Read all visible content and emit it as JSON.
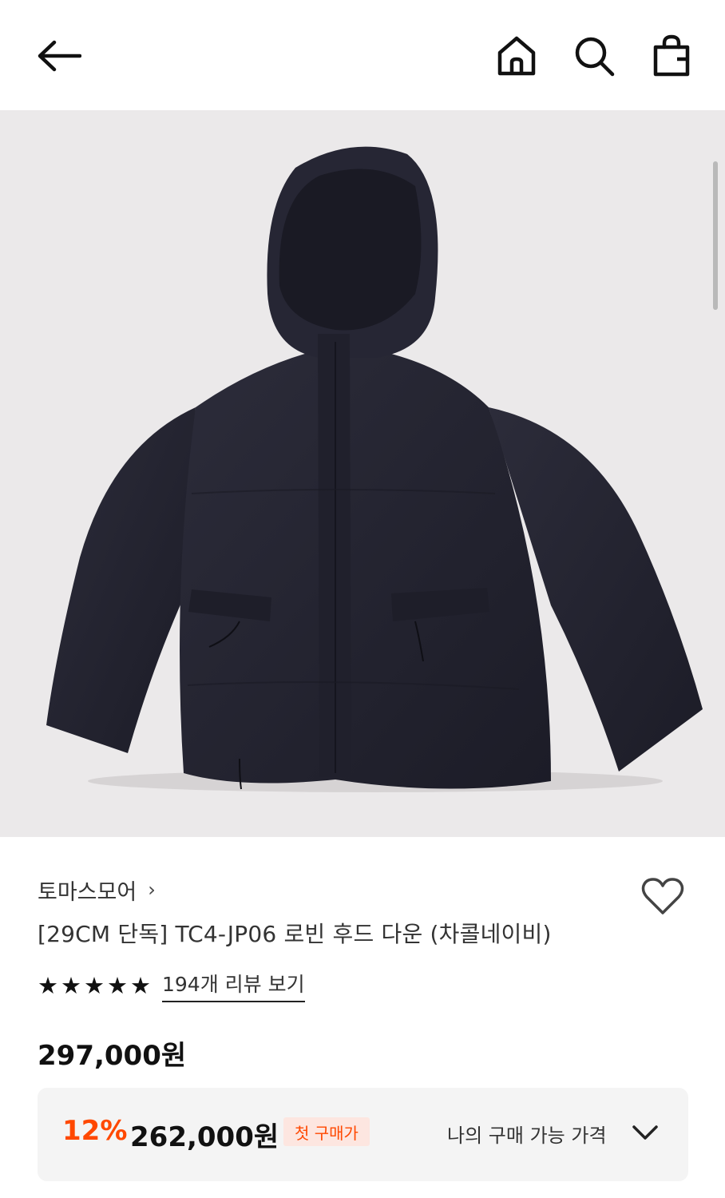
{
  "header": {
    "back_icon": "arrow-left-icon",
    "home_icon": "home-icon",
    "search_icon": "search-icon",
    "bag_icon": "shopping-bag-icon"
  },
  "product": {
    "image_alt": "navy hooded down jacket",
    "brand": "토마스모어",
    "brand_chevron": "›",
    "title": "[29CM 단독] TC4-JP06 로빈 후드 다운 (차콜네이비)",
    "stars": [
      "★",
      "★",
      "★",
      "★",
      "★"
    ],
    "rating_value": 5,
    "review_link": "194개 리뷰 보기",
    "original_price": "297,000원",
    "like_icon": "heart-outline-icon"
  },
  "price_box": {
    "discount": "12%",
    "sale_price": "262,000원",
    "badge": "첫 구매가",
    "my_price_label": "나의 구매 가능 가격",
    "chevron_icon": "chevron-down-icon"
  },
  "colors": {
    "accent": "#ff4800",
    "badge_bg": "#fde6e0",
    "box_bg": "#f4f4f4",
    "image_bg": "#ebe9ea",
    "jacket": "#23232f"
  }
}
